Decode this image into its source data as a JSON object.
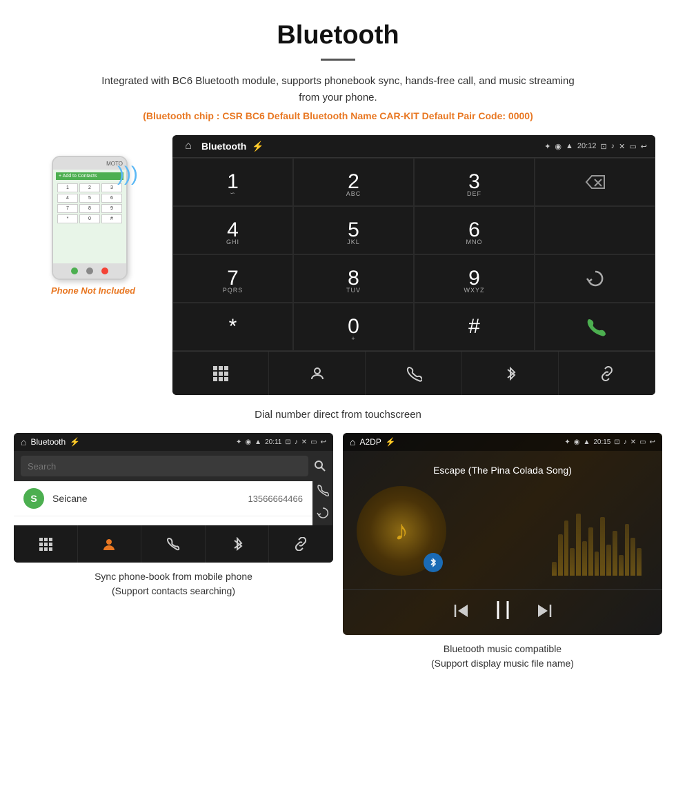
{
  "header": {
    "title": "Bluetooth",
    "description": "Integrated with BC6 Bluetooth module, supports phonebook sync, hands-free call, and music streaming from your phone.",
    "specs": "(Bluetooth chip : CSR BC6   Default Bluetooth Name CAR-KIT   Default Pair Code: 0000)"
  },
  "dial_screen": {
    "title": "Bluetooth",
    "time": "20:12",
    "keys": [
      {
        "num": "1",
        "sub": ""
      },
      {
        "num": "2",
        "sub": "ABC"
      },
      {
        "num": "3",
        "sub": "DEF"
      },
      {
        "num": "4",
        "sub": "GHI"
      },
      {
        "num": "5",
        "sub": "JKL"
      },
      {
        "num": "6",
        "sub": "MNO"
      },
      {
        "num": "7",
        "sub": "PQRS"
      },
      {
        "num": "8",
        "sub": "TUV"
      },
      {
        "num": "9",
        "sub": "WXYZ"
      },
      {
        "num": "*",
        "sub": ""
      },
      {
        "num": "0",
        "sub": "+"
      },
      {
        "num": "#",
        "sub": ""
      }
    ]
  },
  "phonebook_screen": {
    "title": "Bluetooth",
    "time": "20:11",
    "search_placeholder": "Search",
    "contacts": [
      {
        "initial": "S",
        "name": "Seicane",
        "number": "13566664466"
      }
    ]
  },
  "music_screen": {
    "title": "A2DP",
    "time": "20:15",
    "song_title": "Escape (The Pina Colada Song)",
    "eq_bars": [
      20,
      60,
      80,
      40,
      90,
      50,
      70,
      35,
      85,
      45,
      65,
      30,
      75,
      55,
      40
    ]
  },
  "phone_not_included": "Phone Not Included",
  "caption_dial": "Dial number direct from touchscreen",
  "caption_phonebook": "Sync phone-book from mobile phone\n(Support contacts searching)",
  "caption_music": "Bluetooth music compatible\n(Support display music file name)"
}
